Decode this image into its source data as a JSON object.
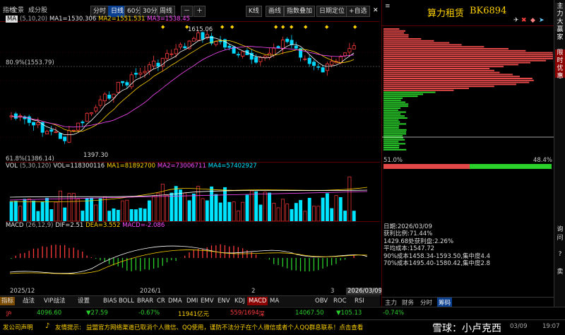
{
  "toolbar": {
    "ma_label": "MA",
    "indicators_label": "指标",
    "all_label": "全景",
    "components_label": "成分股",
    "periods": [
      "分时",
      "日线",
      "60分",
      "30分",
      "周线"
    ],
    "active_period": "日线",
    "kline_label": "K线",
    "draw_label": "画线",
    "overlay_label": "指数叠加",
    "date_locate_label": "日期定位",
    "add_watch_label": "+自选"
  },
  "price_chart": {
    "legend": {
      "prefix": "(5,10,20)",
      "ma1": "MA1=1530.306",
      "ma2": "MA2=1551.531",
      "ma3": "MA3=1538.45"
    },
    "high_label": "1615.06",
    "low_label": "1397.30",
    "pct_top_label": "80.9%(1553.79)",
    "pct_bottom_label": "61.8%(1386.14)"
  },
  "volume_chart": {
    "legend": {
      "name": "VOL",
      "params": "(5,30,120)",
      "vol": "VOL=118300116",
      "ma1": "MA1=81892700",
      "ma2": "MA2=73006711",
      "ma4": "MA4=57402927"
    }
  },
  "macd_chart": {
    "legend": {
      "name": "MACD",
      "params": "(26,12,9)",
      "dif": "DIF=2.51",
      "dea": "DEA=3.552",
      "macd": "MACD=-2.086"
    }
  },
  "time_axis": [
    "2025/12",
    "2026/1",
    "2",
    "3",
    "2026/03/09"
  ],
  "bottom_tabs": [
    "指标",
    "战法",
    "VIP战法",
    "设置",
    "BIAS",
    "BOLL",
    "BRAR",
    "CR",
    "DMA",
    "DMI",
    "EMV",
    "ENV",
    "KDJ",
    "MACD",
    "MA",
    "OBV",
    "ROC",
    "RSI"
  ],
  "active_bottom_tab": "MACD",
  "right_panel": {
    "title": "算力租赁",
    "code": "BK6894",
    "profit_pct_left": "51.0%",
    "profit_pct_right": "48.4%",
    "tabs": [
      "主力",
      "财务",
      "分时",
      "筹码"
    ],
    "active_tab": "筹码",
    "info": [
      "日期:2026/03/09",
      "获利比例:71.44%",
      "1429.68处获利盘:2.26%",
      "平均成本:1547.72",
      "90%成本1458.34-1593.50,集中度4.4",
      "70%成本1495.40-1580.42,集中度2.8"
    ]
  },
  "side_tabs": [
    "主力大赢家",
    "限时优惠"
  ],
  "side_icons": [
    "ask-label",
    "settings-label",
    "question-label",
    "restore-label",
    "close-label"
  ],
  "side_text": [
    "询",
    "问",
    "?",
    "卖"
  ],
  "status_bar": {
    "index1_name": "沪",
    "index1_value": "4096.60",
    "index1_change": "▼27.59",
    "index1_pct": "-0.67%",
    "index1_amount": "11941亿元",
    "up_down": "559/1694",
    "index2_name": "深",
    "index2_value": "14067.50",
    "index2_change": "▼105.13",
    "index2_pct": "-0.74%",
    "notice_label": "发公司声明",
    "tip_label": "友情提示:",
    "tip_text": "益盟官方网络渠道已取消个人微信、QQ使用，谨防不法分子在个人微信或者个人QQ群息联系！点击查看",
    "watermark": "雪球：小卢克西",
    "date": "03/09",
    "time": "19:07"
  },
  "colors": {
    "up": "#ff3b3b",
    "down": "#00d8ff",
    "ma1": "#ffffff",
    "ma2": "#ffd200",
    "ma3": "#ff4dff",
    "vol_up": "#ff3b3b",
    "vol_down": "#00e5ff",
    "macd_pos": "#ff3b3b",
    "macd_neg": "#2bd12b",
    "grid": "#5a0000",
    "active_tab": "#0a3e8e"
  }
}
